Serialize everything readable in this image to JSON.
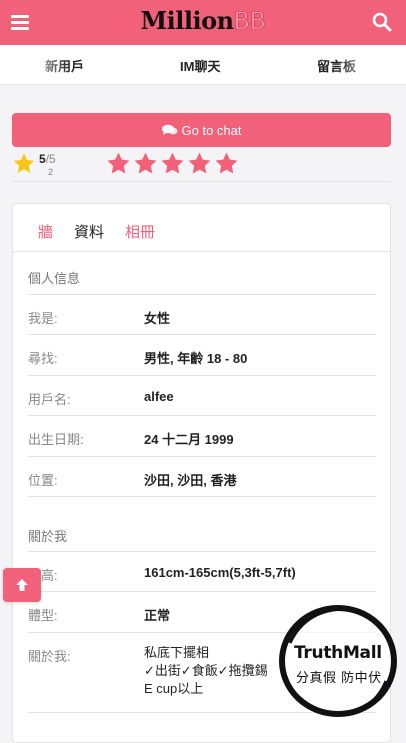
{
  "header": {
    "logo_main": "Million",
    "logo_accent": "BB",
    "brand_color": "#f2617a",
    "menu_icon": "hamburger-menu-icon",
    "search_icon": "search-icon"
  },
  "nav": {
    "items": [
      {
        "label": "新用戶"
      },
      {
        "label": "IM聊天"
      },
      {
        "label": "留言板"
      }
    ]
  },
  "chat_button": {
    "label": "Go to chat",
    "icon": "comments-icon"
  },
  "rating": {
    "score": "5",
    "max": "/5",
    "count": "2",
    "stars_filled": 5,
    "stars_total": 5,
    "star_color": "#f2617a",
    "summary_star_color": "#f5c518"
  },
  "tabs": [
    {
      "label": "牆",
      "active": false
    },
    {
      "label": "資料",
      "active": true
    },
    {
      "label": "相冊",
      "active": false
    }
  ],
  "personal_info": {
    "title": "個人信息",
    "rows": [
      {
        "label": "我是:",
        "value": "女性"
      },
      {
        "label": "尋找:",
        "value": "男性, 年齡 18 - 80"
      },
      {
        "label": "用戶名:",
        "value": "alfee"
      },
      {
        "label": "出生日期:",
        "value": "24 十二月 1999"
      },
      {
        "label": "位置:",
        "value": "沙田, 沙田, 香港"
      }
    ]
  },
  "about_me": {
    "title": "關於我",
    "rows": [
      {
        "label": "身高:",
        "value": "161cm-165cm(5,3ft-5,7ft)"
      },
      {
        "label": "體型:",
        "value": "正常"
      },
      {
        "label": "關於我:",
        "lines": [
          "私底下擺相",
          "✓出街✓食飯✓拖攬錫",
          "E cup以上"
        ]
      }
    ]
  },
  "watermark": {
    "line1": "TruthMall",
    "line2": "分真假 防中伏"
  },
  "scroll_top_icon": "arrow-up-icon"
}
